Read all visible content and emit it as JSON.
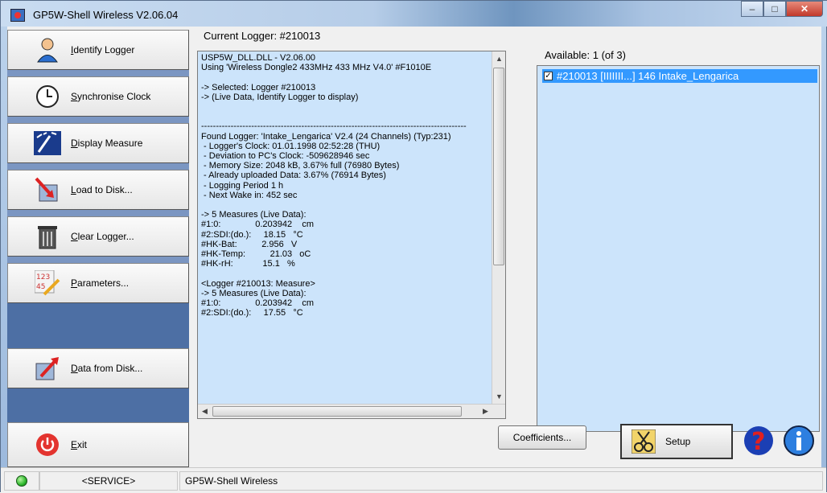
{
  "window": {
    "title": "GP5W-Shell Wireless V2.06.04"
  },
  "sidebar": {
    "items": [
      {
        "label": "Identify Logger",
        "icon": "person-icon"
      },
      {
        "label": "Synchronise Clock",
        "icon": "clock-icon"
      },
      {
        "label": "Display Measure",
        "icon": "gauge-icon"
      },
      {
        "label": "Load to Disk...",
        "icon": "download-arrow-icon"
      },
      {
        "label": "Clear Logger...",
        "icon": "trash-icon"
      },
      {
        "label": "Parameters...",
        "icon": "parameters-icon"
      },
      {
        "label": "Data from Disk...",
        "icon": "upload-arrow-icon"
      },
      {
        "label": "Exit",
        "icon": "power-icon"
      }
    ]
  },
  "current_logger": {
    "title": "Current Logger: #210013",
    "lines": [
      "USP5W_DLL.DLL - V2.06.00",
      "Using 'Wireless Dongle2 433MHz 433 MHz V4.0' #F1010E",
      "",
      "-> Selected: Logger #210013",
      "-> (Live Data, Identify Logger to display)",
      "",
      "",
      "------------------------------------------------------------------------------------------",
      "Found Logger: 'Intake_Lengarica' V2.4 (24 Channels) (Typ:231)",
      " - Logger's Clock: 01.01.1998 02:52:28 (THU)",
      " - Deviation to PC's Clock: -509628946 sec",
      " - Memory Size: 2048 kB, 3.67% full (76980 Bytes)",
      " - Already uploaded Data: 3.67% (76914 Bytes)",
      " - Logging Period 1 h",
      " - Next Wake in: 452 sec",
      "",
      "-> 5 Measures (Live Data):",
      "#1:0:              0.203942    cm",
      "#2:SDI:(do.):     18.15   °C",
      "#HK-Bat:          2.956   V",
      "#HK-Temp:          21.03   oC",
      "#HK-rH:            15.1   %",
      "",
      "<Logger #210013: Measure>",
      "-> 5 Measures (Live Data):",
      "#1:0:              0.203942    cm",
      "#2:SDI:(do.):     17.55   °C"
    ]
  },
  "available": {
    "title": "Available: 1 (of 3)",
    "items": [
      {
        "label": "#210013 [IIIIIII...] 146  Intake_Lengarica",
        "checked": true
      }
    ]
  },
  "buttons": {
    "coefficients": "Coefficients...",
    "setup": "Setup"
  },
  "status": {
    "mode": "<SERVICE>",
    "app": "GP5W-Shell Wireless"
  },
  "colors": {
    "sidebar": "#4d6fa4",
    "log_bg": "#cce4fb",
    "selection": "#3399ff",
    "status_led": "#2db82d"
  }
}
